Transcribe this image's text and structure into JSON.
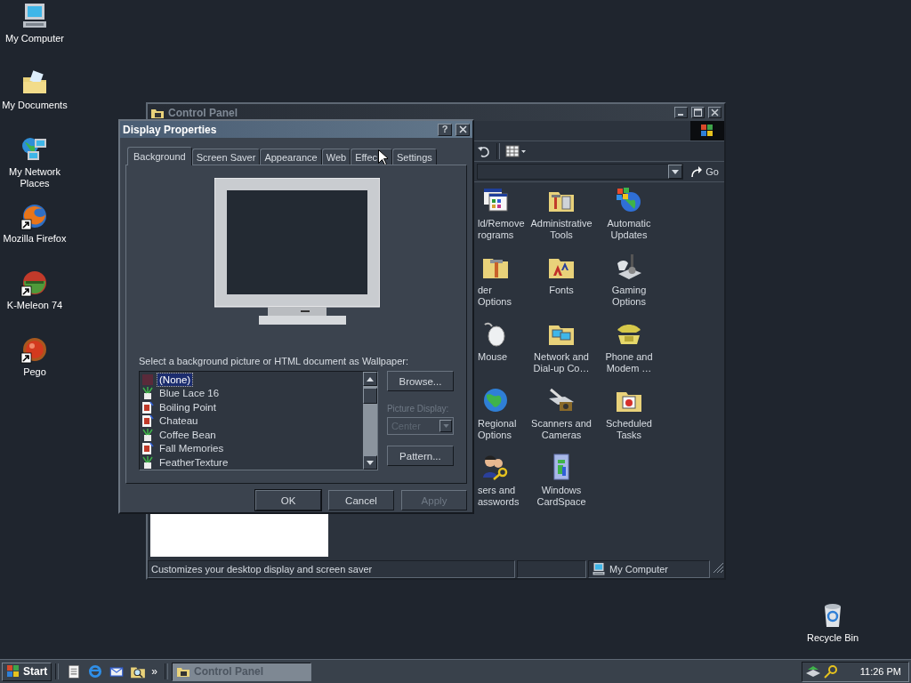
{
  "desktop_icons": [
    {
      "label": "My Computer",
      "kind": "computer",
      "shortcut": false
    },
    {
      "label": "My Documents",
      "kind": "documents",
      "shortcut": false
    },
    {
      "label": "My Network Places",
      "kind": "network",
      "shortcut": false
    },
    {
      "label": "Mozilla Firefox",
      "kind": "firefox",
      "shortcut": true
    },
    {
      "label": "K-Meleon 74",
      "kind": "kmeleon",
      "shortcut": true
    },
    {
      "label": "Pego",
      "kind": "pego",
      "shortcut": true
    }
  ],
  "recycle_bin": {
    "label": "Recycle Bin"
  },
  "control_panel": {
    "title": "Control Panel",
    "active": false,
    "go": "Go",
    "items": [
      {
        "label": "ld/Remove rograms",
        "kind": "addremove"
      },
      {
        "label": "Administrative Tools",
        "kind": "admintools"
      },
      {
        "label": "Automatic Updates",
        "kind": "updates"
      },
      {
        "label": "der Options",
        "kind": "folderoptions"
      },
      {
        "label": "Fonts",
        "kind": "fonts"
      },
      {
        "label": "Gaming Options",
        "kind": "gaming"
      },
      {
        "label": "Mouse",
        "kind": "mouse"
      },
      {
        "label": "Network and Dial-up Co…",
        "kind": "netfolder"
      },
      {
        "label": "Phone and Modem …",
        "kind": "phone"
      },
      {
        "label": "Regional Options",
        "kind": "regional"
      },
      {
        "label": "Scanners and Cameras",
        "kind": "scanners"
      },
      {
        "label": "Scheduled Tasks",
        "kind": "scheduled"
      },
      {
        "label": "sers and asswords",
        "kind": "users"
      },
      {
        "label": "Windows CardSpace",
        "kind": "cardspace"
      }
    ],
    "status": {
      "text": "Customizes your desktop display and screen saver",
      "zone": "My Computer"
    }
  },
  "dialog": {
    "title": "Display Properties",
    "help": "?",
    "tabs": [
      {
        "label": "Background",
        "selected": true
      },
      {
        "label": "Screen Saver",
        "selected": false
      },
      {
        "label": "Appearance",
        "selected": false
      },
      {
        "label": "Web",
        "selected": false
      },
      {
        "label": "Effec",
        "selected": false
      },
      {
        "label": "Settings",
        "selected": false
      }
    ],
    "wallpaper_label": "Select a background picture or HTML document as Wallpaper:",
    "wallpapers": [
      {
        "label": "(None)",
        "kind": "none",
        "selected": true
      },
      {
        "label": "Blue Lace 16",
        "kind": "bitmap",
        "selected": false
      },
      {
        "label": "Boiling Point",
        "kind": "photo",
        "selected": false
      },
      {
        "label": "Chateau",
        "kind": "photo",
        "selected": false
      },
      {
        "label": "Coffee Bean",
        "kind": "bitmap",
        "selected": false
      },
      {
        "label": "Fall Memories",
        "kind": "photo",
        "selected": false
      },
      {
        "label": "FeatherTexture",
        "kind": "bitmap",
        "selected": false
      }
    ],
    "browse": "Browse...",
    "picture_display": {
      "label": "Picture Display:",
      "value": "Center",
      "disabled": true
    },
    "pattern": "Pattern...",
    "buttons": [
      {
        "label": "OK",
        "disabled": false,
        "default": true
      },
      {
        "label": "Cancel",
        "disabled": false,
        "default": false
      },
      {
        "label": "Apply",
        "disabled": true,
        "default": false
      }
    ]
  },
  "taskbar": {
    "start": "Start",
    "quick_launch": [
      {
        "kind": "notepad"
      },
      {
        "kind": "browser"
      },
      {
        "kind": "mail"
      },
      {
        "kind": "search"
      }
    ],
    "overflow": "»",
    "tasks": [
      {
        "label": "Control Panel",
        "selected": true
      }
    ],
    "clock": "11:26 PM"
  }
}
